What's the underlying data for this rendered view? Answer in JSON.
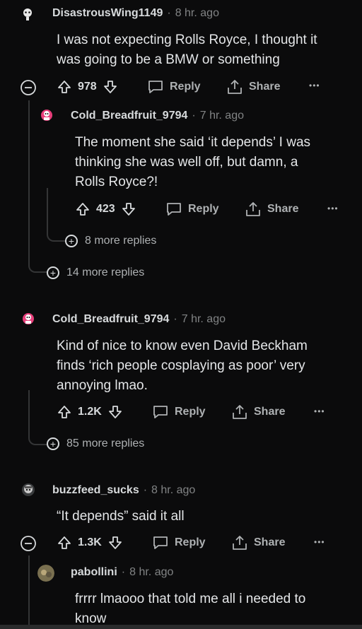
{
  "comments": [
    {
      "username": "DisastrousWing1149",
      "time": "8 hr. ago",
      "lines": [
        "I was not expecting Rolls Royce, I thought it",
        "was going to be a BMW or something"
      ],
      "votes": "978",
      "reply": "Reply",
      "share": "Share",
      "more": "•••"
    },
    {
      "username": "Cold_Breadfruit_9794",
      "time": "7 hr. ago",
      "lines": [
        "The moment she said ‘it depends’ I was",
        "thinking she was well off, but damn, a",
        "Rolls Royce?!"
      ],
      "votes": "423",
      "reply": "Reply",
      "share": "Share",
      "more": "•••",
      "more_replies": "8 more replies"
    },
    {
      "more_replies": "14 more replies"
    },
    {
      "username": "Cold_Breadfruit_9794",
      "time": "7 hr. ago",
      "lines": [
        "Kind of nice to know even David Beckham",
        "finds ‘rich people cosplaying as poor’ very",
        "annoying lmao."
      ],
      "votes": "1.2K",
      "reply": "Reply",
      "share": "Share",
      "more": "•••",
      "more_replies": "85 more replies"
    },
    {
      "username": "buzzfeed_sucks",
      "time": "8 hr. ago",
      "lines": [
        "“It depends” said it all"
      ],
      "votes": "1.3K",
      "reply": "Reply",
      "share": "Share",
      "more": "•••"
    },
    {
      "username": "pabollini",
      "time": "8 hr. ago",
      "lines": [
        "frrrr lmaooo that told me all i needed to",
        "know"
      ]
    }
  ],
  "colors": {
    "bg": "#0b0b0c",
    "text": "#d7dadc",
    "muted": "#818384",
    "thread": "#343536"
  }
}
